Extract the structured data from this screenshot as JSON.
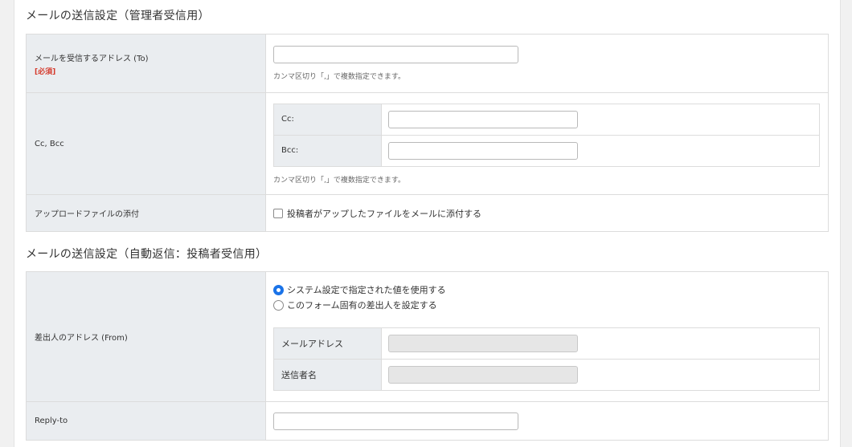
{
  "admin_section": {
    "title": "メールの送信設定（管理者受信用）",
    "to_row": {
      "label": "メールを受信するアドレス (To)",
      "required": "[必須]",
      "value": "",
      "help": "カンマ区切り「,」で複数指定できます。"
    },
    "ccbcc_row": {
      "label": "Cc, Bcc",
      "cc_label": "Cc:",
      "cc_value": "",
      "bcc_label": "Bcc:",
      "bcc_value": "",
      "help": "カンマ区切り「,」で複数指定できます。"
    },
    "attach_row": {
      "label": "アップロードファイルの添付",
      "checkbox_label": "投稿者がアップしたファイルをメールに添付する",
      "checked": false
    }
  },
  "auto_section": {
    "title": "メールの送信設定（自動返信：投稿者受信用）",
    "from_row": {
      "label": "差出人のアドレス (From)",
      "options": [
        {
          "label": "システム設定で指定された値を使用する",
          "selected": true
        },
        {
          "label": "このフォーム固有の差出人を設定する",
          "selected": false
        }
      ],
      "mail_label": "メールアドレス",
      "mail_value": "",
      "sender_label": "送信者名",
      "sender_value": ""
    },
    "replyto_row": {
      "label": "Reply-to",
      "value": ""
    }
  },
  "colors": {
    "label_bg": "#eaedf0",
    "required": "#d53a2c",
    "radio_accent": "#1a73e8"
  }
}
